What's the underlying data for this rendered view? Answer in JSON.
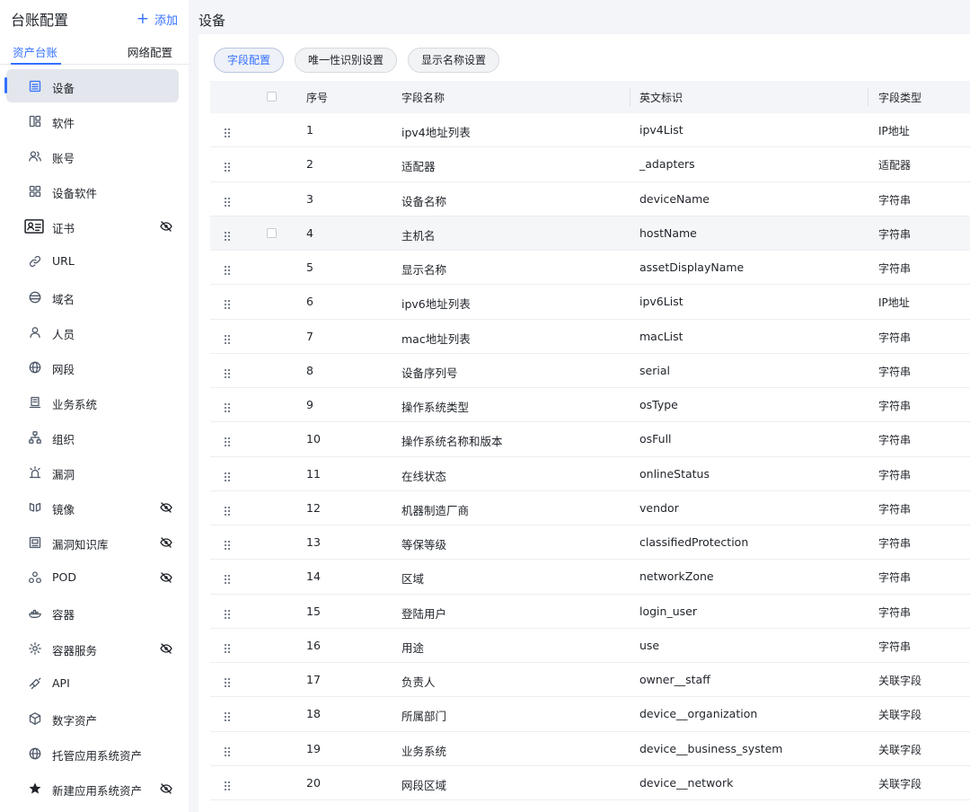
{
  "sidebar": {
    "title": "台账配置",
    "add_label": "添加",
    "tabs": [
      "资产台账",
      "网络配置"
    ],
    "items": [
      {
        "label": "设备",
        "icon": "list-icon",
        "active": true,
        "hidden": false
      },
      {
        "label": "软件",
        "icon": "grid-icon",
        "hidden": false
      },
      {
        "label": "账号",
        "icon": "users-icon",
        "hidden": false
      },
      {
        "label": "设备软件",
        "icon": "apps-icon",
        "hidden": false
      },
      {
        "label": "证书",
        "icon": "id-card-icon",
        "hidden": true
      },
      {
        "label": "URL",
        "icon": "link-icon",
        "hidden": false
      },
      {
        "label": "域名",
        "icon": "domain-icon",
        "hidden": false
      },
      {
        "label": "人员",
        "icon": "user-icon",
        "hidden": false
      },
      {
        "label": "网段",
        "icon": "globe-icon",
        "hidden": false
      },
      {
        "label": "业务系统",
        "icon": "server-icon",
        "hidden": false
      },
      {
        "label": "组织",
        "icon": "org-icon",
        "hidden": false
      },
      {
        "label": "漏洞",
        "icon": "bug-icon",
        "hidden": false
      },
      {
        "label": "镜像",
        "icon": "mirror-icon",
        "hidden": true
      },
      {
        "label": "漏洞知识库",
        "icon": "library-icon",
        "hidden": true
      },
      {
        "label": "POD",
        "icon": "pod-icon",
        "hidden": true
      },
      {
        "label": "容器",
        "icon": "container-icon",
        "hidden": false
      },
      {
        "label": "容器服务",
        "icon": "gear-icon",
        "hidden": true
      },
      {
        "label": "API",
        "icon": "api-icon",
        "hidden": false
      },
      {
        "label": "数字资产",
        "icon": "cube-icon",
        "hidden": false
      },
      {
        "label": "托管应用系统资产",
        "icon": "globe-icon",
        "hidden": false
      },
      {
        "label": "新建应用系统资产",
        "icon": "star-icon",
        "hidden": true
      }
    ]
  },
  "main": {
    "title": "设备",
    "buttons": [
      "字段配置",
      "唯一性识别设置",
      "显示名称设置"
    ],
    "active_button": 0,
    "columns": {
      "num": "序号",
      "name": "字段名称",
      "en": "英文标识",
      "type": "字段类型"
    },
    "rows": [
      {
        "num": "1",
        "name": "ipv4地址列表",
        "en": "ipv4List",
        "type": "IP地址"
      },
      {
        "num": "2",
        "name": "适配器",
        "en": "_adapters",
        "type": "适配器"
      },
      {
        "num": "3",
        "name": "设备名称",
        "en": "deviceName",
        "type": "字符串"
      },
      {
        "num": "4",
        "name": "主机名",
        "en": "hostName",
        "type": "字符串"
      },
      {
        "num": "5",
        "name": "显示名称",
        "en": "assetDisplayName",
        "type": "字符串"
      },
      {
        "num": "6",
        "name": "ipv6地址列表",
        "en": "ipv6List",
        "type": "IP地址"
      },
      {
        "num": "7",
        "name": "mac地址列表",
        "en": "macList",
        "type": "字符串"
      },
      {
        "num": "8",
        "name": "设备序列号",
        "en": "serial",
        "type": "字符串"
      },
      {
        "num": "9",
        "name": "操作系统类型",
        "en": "osType",
        "type": "字符串"
      },
      {
        "num": "10",
        "name": "操作系统名称和版本",
        "en": "osFull",
        "type": "字符串"
      },
      {
        "num": "11",
        "name": "在线状态",
        "en": "onlineStatus",
        "type": "字符串"
      },
      {
        "num": "12",
        "name": "机器制造厂商",
        "en": "vendor",
        "type": "字符串"
      },
      {
        "num": "13",
        "name": "等保等级",
        "en": "classifiedProtection",
        "type": "字符串"
      },
      {
        "num": "14",
        "name": "区域",
        "en": "networkZone",
        "type": "字符串"
      },
      {
        "num": "15",
        "name": "登陆用户",
        "en": "login_user",
        "type": "字符串"
      },
      {
        "num": "16",
        "name": "用途",
        "en": "use",
        "type": "字符串"
      },
      {
        "num": "17",
        "name": "负责人",
        "en": "owner__staff",
        "type": "关联字段"
      },
      {
        "num": "18",
        "name": "所属部门",
        "en": "device__organization",
        "type": "关联字段"
      },
      {
        "num": "19",
        "name": "业务系统",
        "en": "device__business_system",
        "type": "关联字段"
      },
      {
        "num": "20",
        "name": "网段区域",
        "en": "device__network",
        "type": "关联字段"
      }
    ],
    "hover_row": 3
  },
  "colors": {
    "accent": "#3370ff",
    "active_bg": "#e3e6ec",
    "header_bg": "#f3f5f8"
  }
}
